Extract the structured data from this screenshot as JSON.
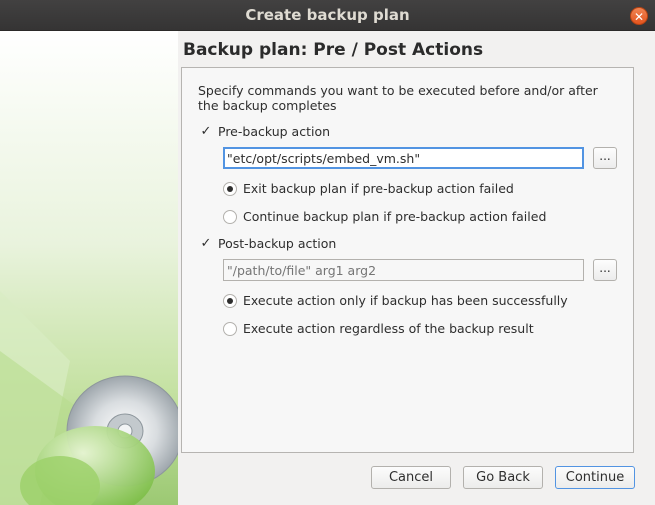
{
  "window": {
    "title": "Create backup plan"
  },
  "page": {
    "title": "Backup plan: Pre / Post Actions",
    "description": "Specify commands you want to be executed before and/or after the backup completes"
  },
  "pre_backup": {
    "checkbox_label": "Pre-backup action",
    "checked": true,
    "command_value": "\"etc/opt/scripts/embed_vm.sh\"",
    "browse_label": "...",
    "options": [
      {
        "label": "Exit backup plan if pre-backup action failed",
        "selected": true
      },
      {
        "label": "Continue backup plan if pre-backup action failed",
        "selected": false
      }
    ]
  },
  "post_backup": {
    "checkbox_label": "Post-backup action",
    "checked": true,
    "command_placeholder": "\"/path/to/file\" arg1 arg2",
    "browse_label": "...",
    "options": [
      {
        "label": "Execute action only if backup has been successfully",
        "selected": true
      },
      {
        "label": "Execute action regardless of the backup result",
        "selected": false
      }
    ]
  },
  "footer": {
    "cancel_label": "Cancel",
    "back_label": "Go Back",
    "continue_label": "Continue"
  },
  "icons": {
    "close": "close-icon",
    "checkmark": "checkmark-icon",
    "banner": "disc-banner-illustration"
  },
  "colors": {
    "accent": "#5294e2",
    "titlebar": "#3c3b37",
    "close": "#e95420"
  }
}
